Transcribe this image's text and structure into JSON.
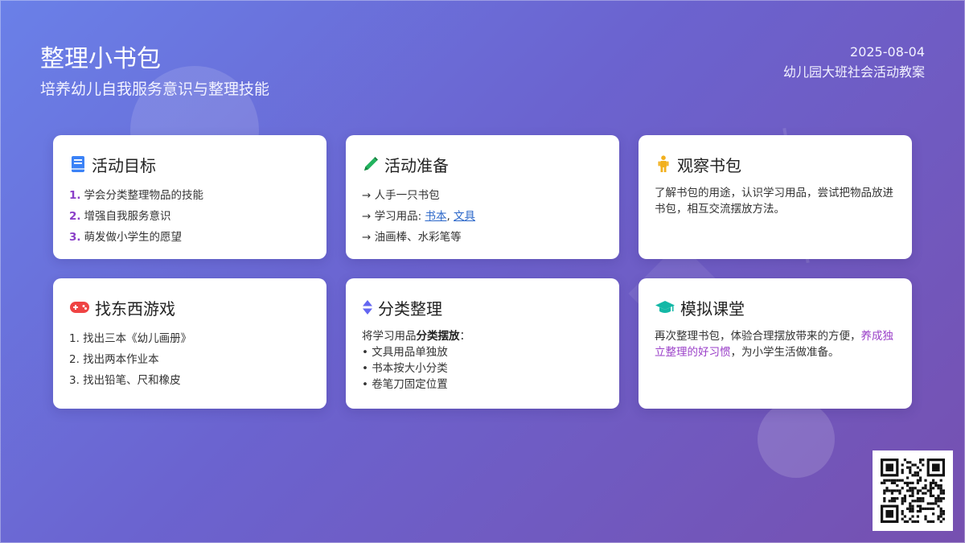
{
  "header": {
    "title": "整理小书包",
    "subtitle": "培养幼儿自我服务意识与整理技能",
    "date": "2025-08-04",
    "doc_type": "幼儿园大班社会活动教案"
  },
  "cards": {
    "goals": {
      "icon": "book-icon",
      "title": "活动目标",
      "items": [
        {
          "num": "1.",
          "text": "学会分类整理物品的技能"
        },
        {
          "num": "2.",
          "text": "增强自我服务意识"
        },
        {
          "num": "3.",
          "text": "萌发做小学生的愿望"
        }
      ]
    },
    "prep": {
      "icon": "pencil-icon",
      "title": "活动准备",
      "items": [
        "→ 人手一只书包",
        "→ 学习用品: ",
        "→ 油画棒、水彩笔等"
      ],
      "links": [
        "书本",
        "文具"
      ],
      "sep": ", "
    },
    "observe": {
      "icon": "child-icon",
      "title": "观察书包",
      "text": "了解书包的用途，认识学习用品，尝试把物品放进书包，相互交流摆放方法。"
    },
    "game": {
      "icon": "gamepad-icon",
      "title": "找东西游戏",
      "items": [
        "1. 找出三本《幼儿画册》",
        "2. 找出两本作业本",
        "3. 找出铅笔、尺和橡皮"
      ]
    },
    "sort": {
      "icon": "sort-icon",
      "title": "分类整理",
      "intro_pre": "将学习用品",
      "intro_bold": "分类摆放",
      "intro_post": "：",
      "bullets": [
        "• 文具用品单独放",
        "• 书本按大小分类",
        "• 卷笔刀固定位置"
      ]
    },
    "class": {
      "icon": "graduation-cap-icon",
      "title": "模拟课堂",
      "text_pre": "再次整理书包，体验合理摆放带来的方便，",
      "text_accent": "养成独立整理的好习惯",
      "text_post": "，为小学生活做准备。"
    }
  },
  "qr": {
    "icon": "qr-code-icon"
  }
}
